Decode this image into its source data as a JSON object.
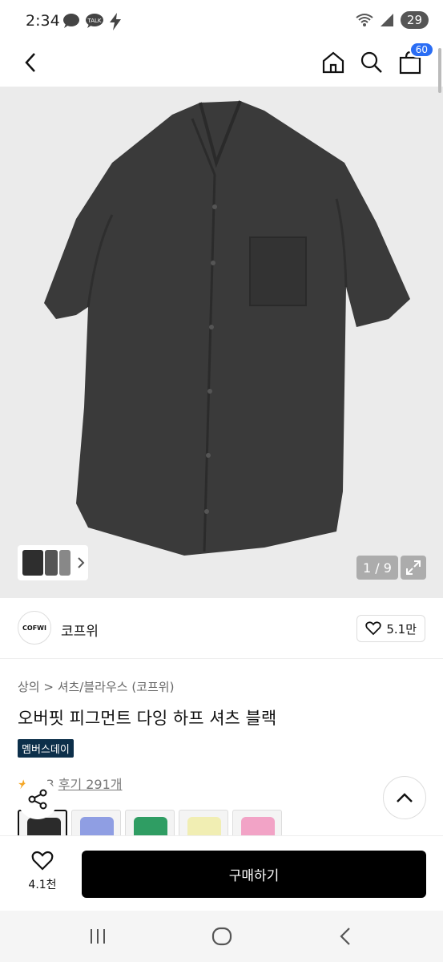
{
  "status": {
    "time": "2:34",
    "left_icons": [
      "chat-bubble-icon",
      "talk-icon",
      "bolt-icon"
    ],
    "talk_label": "TALK",
    "battery": "29"
  },
  "appbar": {
    "cart_count": "60"
  },
  "gallery": {
    "counter": "1 / 9"
  },
  "brand": {
    "logo_text": "COFWI",
    "name": "코프위",
    "likes": "5.1만"
  },
  "product": {
    "breadcrumb": "상의 > 셔츠/블라우스 (코프위)",
    "title": "오버핏 피그먼트 다잉 하프 셔츠 블랙",
    "badge": "멤버스데이",
    "rating_partial": "3",
    "reviews": "후기 291개"
  },
  "swatches": [
    {
      "color": "#2b2b2b"
    },
    {
      "color": "#8f9ee3"
    },
    {
      "color": "#2f9d63"
    },
    {
      "color": "#f1eeb3"
    },
    {
      "color": "#f2a3c6"
    }
  ],
  "bottom": {
    "wish_count": "4.1천",
    "buy_label": "구매하기"
  }
}
